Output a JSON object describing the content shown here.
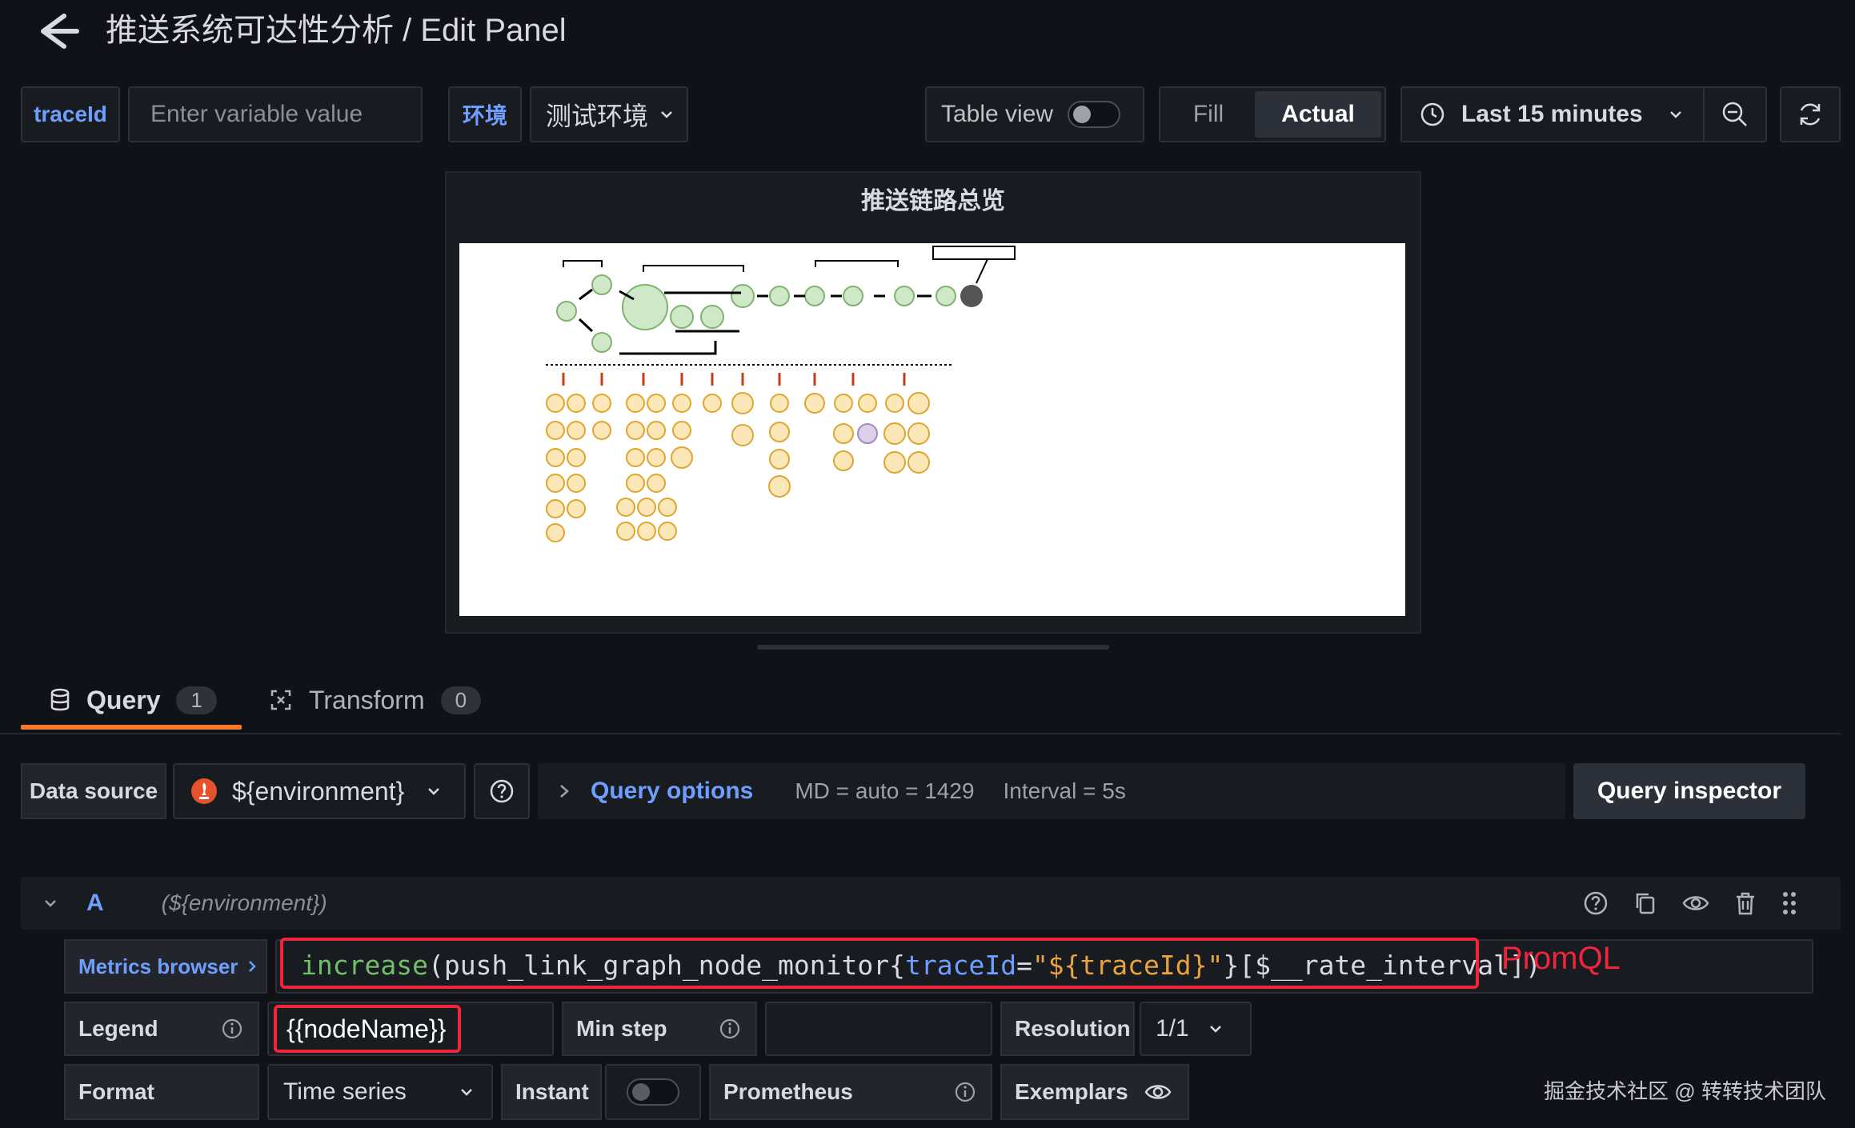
{
  "header": {
    "title": "推送系统可达性分析 / Edit Panel"
  },
  "variables": {
    "traceid_label": "traceId",
    "traceid_placeholder": "Enter variable value",
    "env_label": "环境",
    "env_value": "测试环境"
  },
  "toolbar": {
    "table_view_label": "Table view",
    "fill_label": "Fill",
    "actual_label": "Actual",
    "time_range": "Last 15 minutes"
  },
  "panel": {
    "title": "推送链路总览"
  },
  "tabs": [
    {
      "label": "Query",
      "count": "1"
    },
    {
      "label": "Transform",
      "count": "0"
    }
  ],
  "query": {
    "data_source_label": "Data source",
    "data_source_value": "${environment}",
    "query_options_label": "Query options",
    "md_text": "MD = auto = 1429",
    "interval_text": "Interval = 5s",
    "inspector_label": "Query inspector",
    "ref_id": "A",
    "ref_ds": "(${environment})",
    "metrics_browser_label": "Metrics browser",
    "expr_fn": "increase",
    "expr_open": "(push_link_graph_node_monitor{",
    "expr_key": "traceId",
    "expr_eq": "=",
    "expr_val": "\"${traceId}\"",
    "expr_close": "}[$__rate_interval])",
    "promql_annotation": "PromQL",
    "legend_label": "Legend",
    "legend_value": "{{nodeName}}",
    "min_step_label": "Min step",
    "resolution_label": "Resolution",
    "resolution_value": "1/1",
    "format_label": "Format",
    "format_value": "Time series",
    "instant_label": "Instant",
    "type_label": "Prometheus",
    "exemplars_label": "Exemplars"
  },
  "watermark": "掘金技术社区 @ 转转技术团队",
  "colors": {
    "accent_blue": "#6e9fff",
    "active_tab_orange": "#f5792a",
    "annotation_red": "#f0253d",
    "prometheus_red": "#e6522c"
  }
}
